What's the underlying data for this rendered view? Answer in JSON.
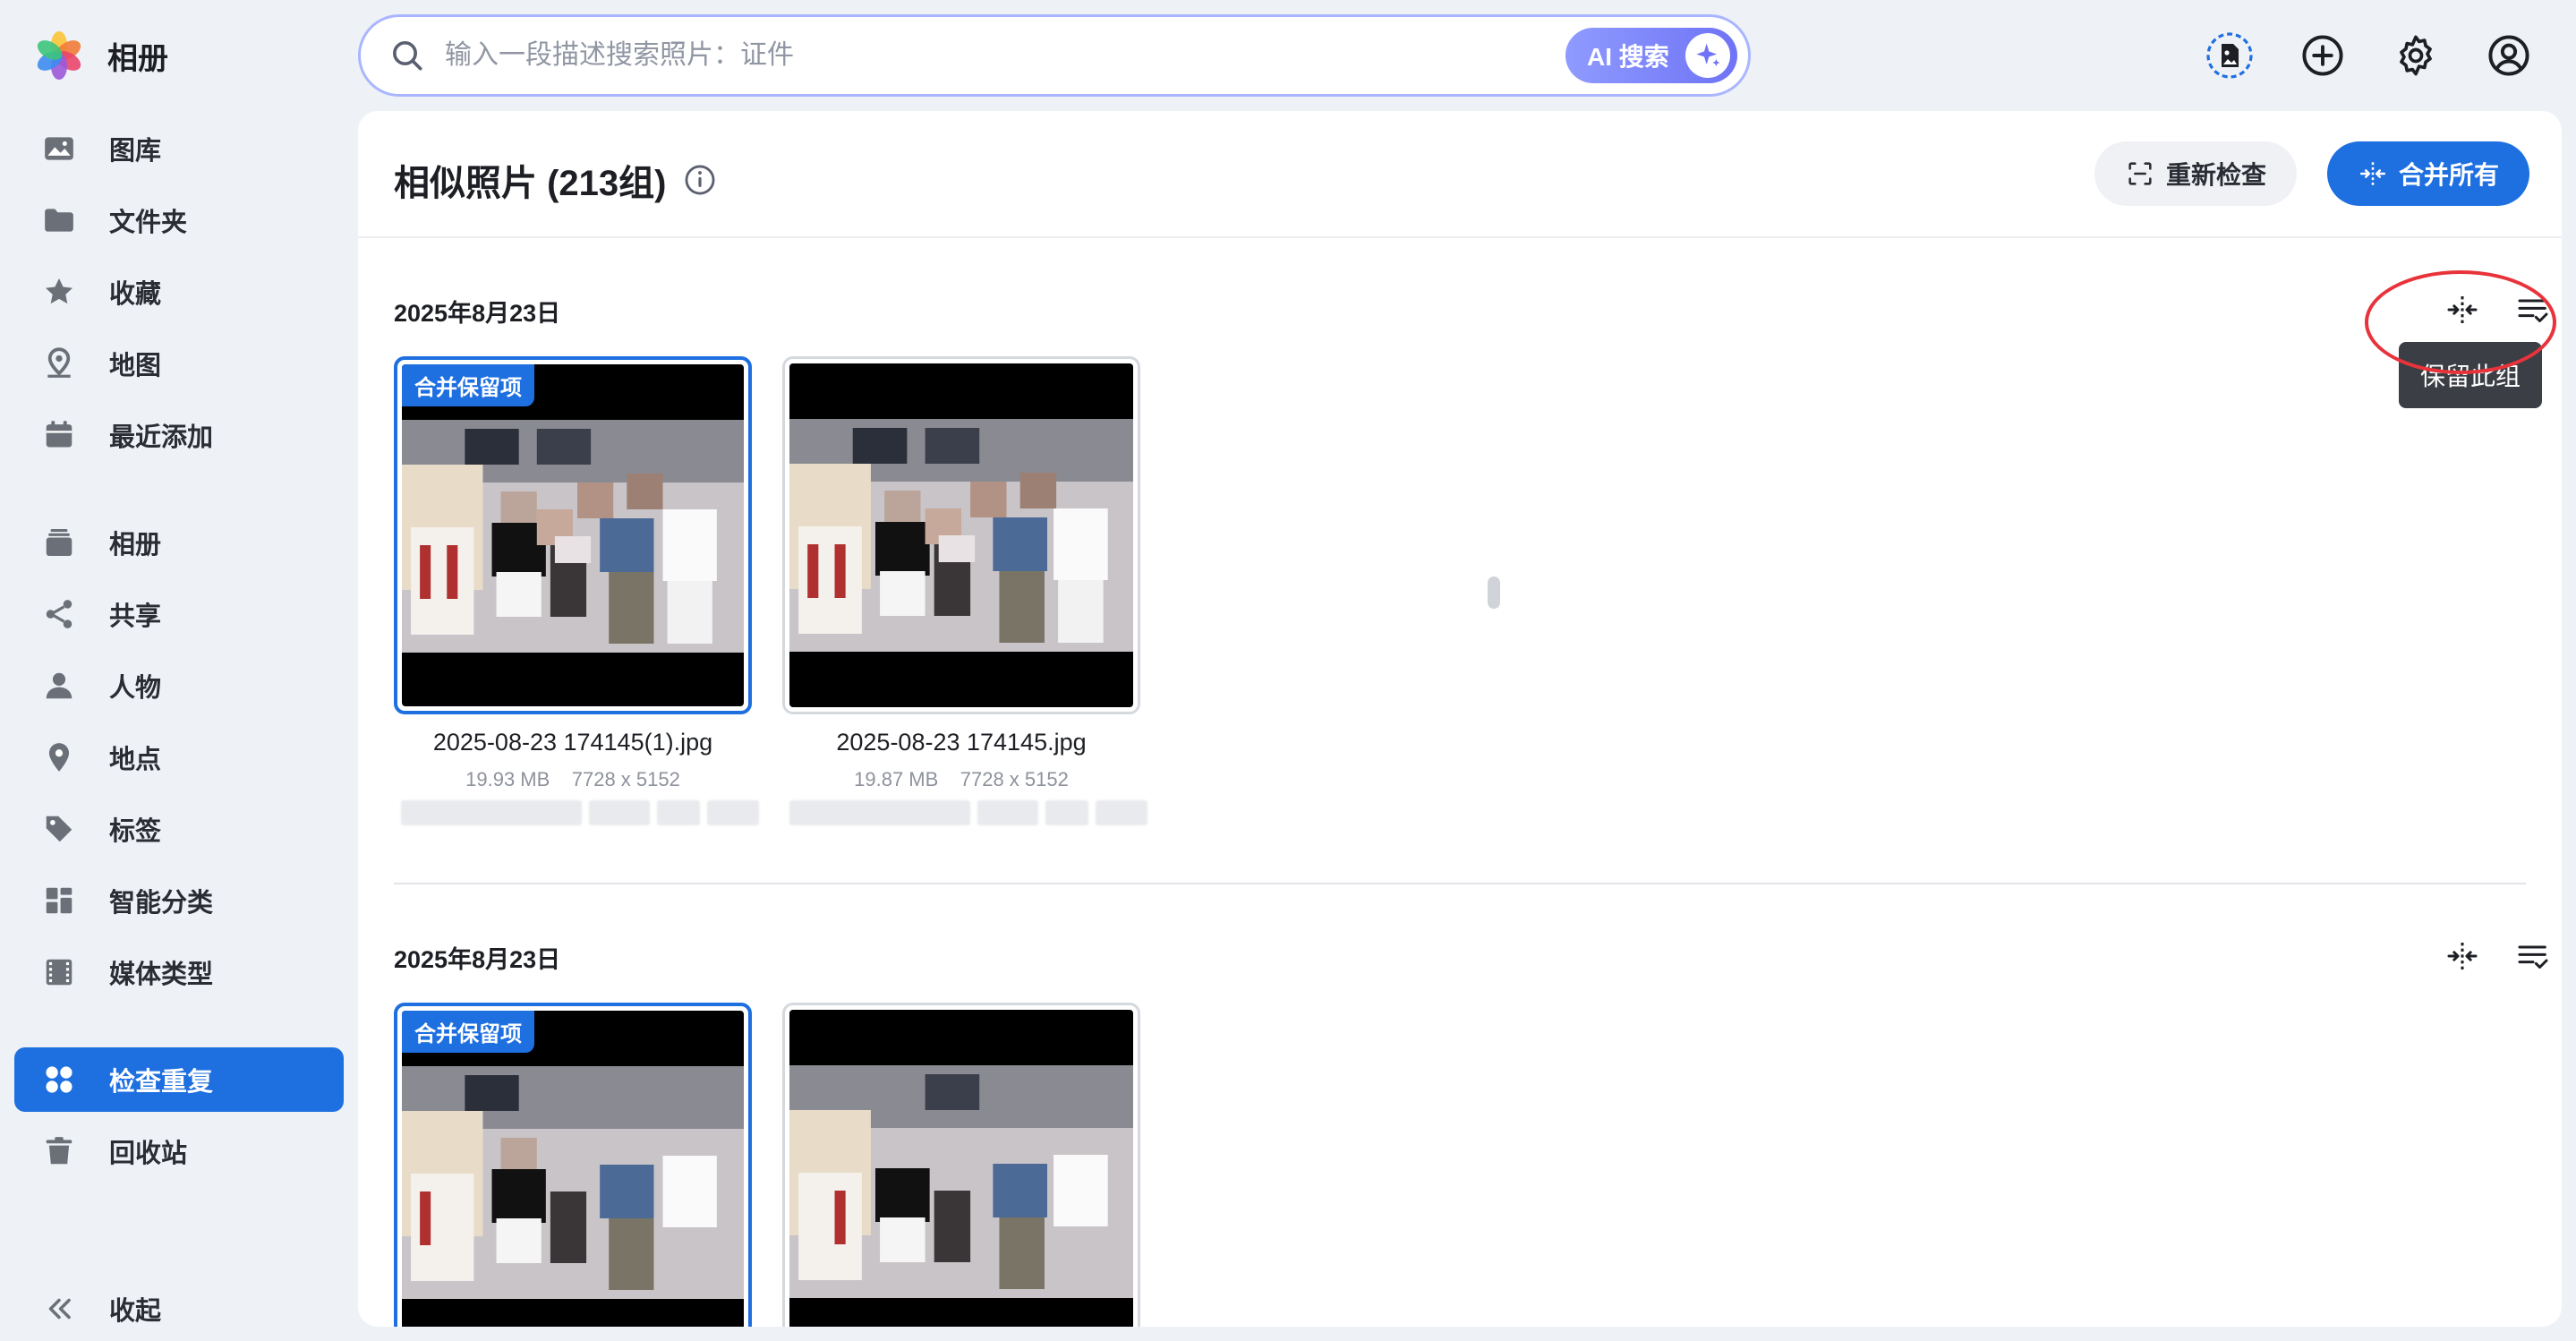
{
  "app": {
    "title": "相册"
  },
  "sidebar": {
    "items": [
      {
        "label": "图库",
        "icon": "image-icon"
      },
      {
        "label": "文件夹",
        "icon": "folder-icon"
      },
      {
        "label": "收藏",
        "icon": "star-icon"
      },
      {
        "label": "地图",
        "icon": "map-pin-icon"
      },
      {
        "label": "最近添加",
        "icon": "calendar-icon"
      },
      {
        "label": "相册",
        "icon": "albums-icon"
      },
      {
        "label": "共享",
        "icon": "share-icon"
      },
      {
        "label": "人物",
        "icon": "person-icon"
      },
      {
        "label": "地点",
        "icon": "location-icon"
      },
      {
        "label": "标签",
        "icon": "tag-icon"
      },
      {
        "label": "智能分类",
        "icon": "grid-icon"
      },
      {
        "label": "媒体类型",
        "icon": "film-icon"
      },
      {
        "label": "检查重复",
        "icon": "duplicates-icon",
        "active": true
      },
      {
        "label": "回收站",
        "icon": "trash-icon"
      }
    ],
    "collapse_label": "收起"
  },
  "search": {
    "placeholder": "输入一段描述搜索照片：证件",
    "ai_button_label": "AI 搜索"
  },
  "toolbar_icons": [
    "photo-doc-icon",
    "add-icon",
    "settings-icon",
    "account-icon"
  ],
  "main": {
    "title": "相似照片 (213组)",
    "recheck_label": "重新检查",
    "merge_all_label": "合并所有",
    "tooltip": "保留此组",
    "groups": [
      {
        "date": "2025年8月23日",
        "photos": [
          {
            "name": "2025-08-23 174145(1).jpg",
            "size": "19.93 MB",
            "dims": "7728 x 5152",
            "badge": "合并保留项"
          },
          {
            "name": "2025-08-23 174145.jpg",
            "size": "19.87 MB",
            "dims": "7728 x 5152"
          }
        ]
      },
      {
        "date": "2025年8月23日",
        "photos": [
          {
            "badge": "合并保留项"
          },
          {}
        ]
      }
    ]
  },
  "colors": {
    "accent": "#1e6fe0",
    "annotation": "#e8333b",
    "ai_gradient_start": "#8f9bff",
    "ai_gradient_end": "#6f73f5"
  }
}
